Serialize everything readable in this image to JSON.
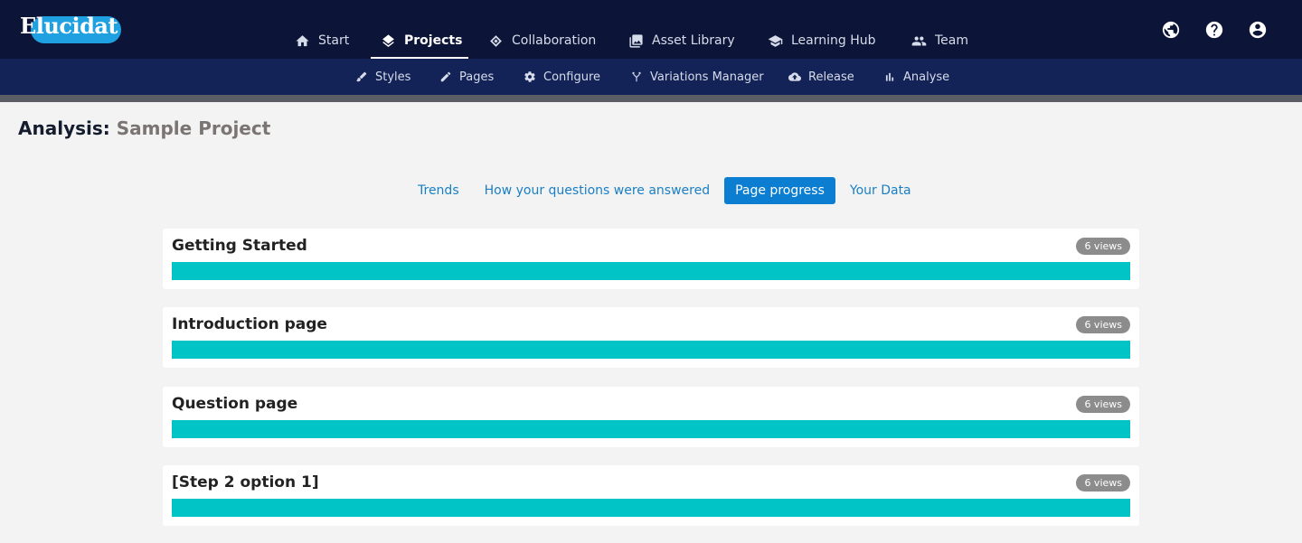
{
  "app": {
    "logo_text": "Elucidat",
    "nav": [
      {
        "label": "Start",
        "icon": "home-icon"
      },
      {
        "label": "Projects",
        "icon": "layers-icon",
        "active": true
      },
      {
        "label": "Collaboration",
        "icon": "collaboration-icon"
      },
      {
        "label": "Asset Library",
        "icon": "images-icon"
      },
      {
        "label": "Learning Hub",
        "icon": "graduation-cap-icon"
      },
      {
        "label": "Team",
        "icon": "team-icon"
      }
    ],
    "right_icons": [
      "globe-icon",
      "help-icon",
      "account-icon"
    ]
  },
  "subnav": [
    {
      "label": "Styles",
      "icon": "brush-icon"
    },
    {
      "label": "Pages",
      "icon": "pencil-icon"
    },
    {
      "label": "Configure",
      "icon": "gear-icon"
    },
    {
      "label": "Variations Manager",
      "icon": "fork-icon"
    },
    {
      "label": "Release",
      "icon": "cloud-upload-icon"
    },
    {
      "label": "Analyse",
      "icon": "bar-chart-icon"
    }
  ],
  "page": {
    "title_prefix": "Analysis:",
    "project_name": "Sample Project"
  },
  "tabs": [
    {
      "label": "Trends"
    },
    {
      "label": "How your questions were answered"
    },
    {
      "label": "Page progress",
      "active": true
    },
    {
      "label": "Your Data"
    }
  ],
  "pages": [
    {
      "title": "Getting Started",
      "views": "6 views",
      "progress": 1.0
    },
    {
      "title": "Introduction page",
      "views": "6 views",
      "progress": 1.0
    },
    {
      "title": "Question page",
      "views": "6 views",
      "progress": 1.0
    },
    {
      "title": "[Step 2 option 1]",
      "views": "6 views",
      "progress": 1.0
    }
  ],
  "colors": {
    "topbar": "#0c1538",
    "subbar": "#132257",
    "accent": "#0b7ed1",
    "progress": "#00c4c6",
    "badge": "#8c8c8c"
  }
}
